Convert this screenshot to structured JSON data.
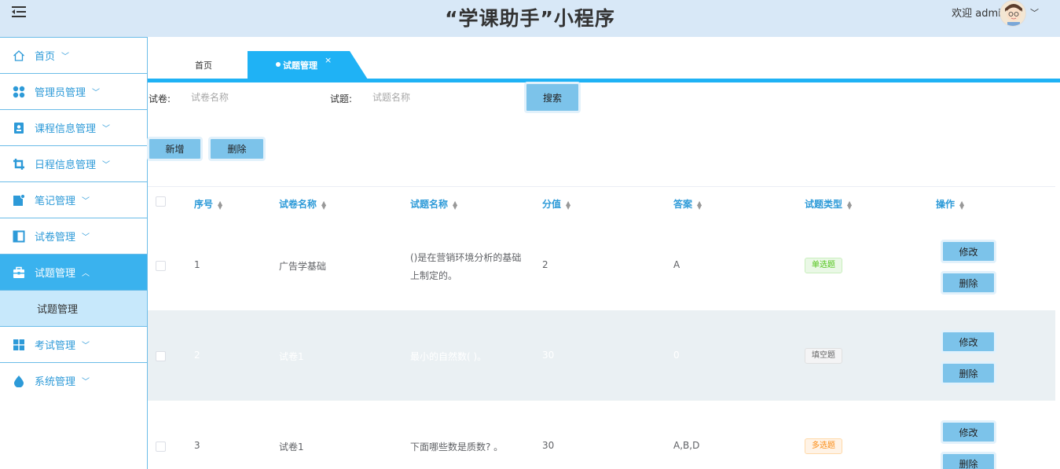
{
  "header": {
    "title": "“学课助手”小程序",
    "welcome": "欢迎 admin"
  },
  "sidebar": {
    "items": [
      {
        "label": "首页",
        "icon": "home-icon"
      },
      {
        "label": "管理员管理",
        "icon": "grid-dots-icon"
      },
      {
        "label": "课程信息管理",
        "icon": "contact-book-icon"
      },
      {
        "label": "日程信息管理",
        "icon": "crop-icon"
      },
      {
        "label": "笔记管理",
        "icon": "note-icon"
      },
      {
        "label": "试卷管理",
        "icon": "panel-icon"
      },
      {
        "label": "试题管理",
        "icon": "toolbox-icon"
      },
      {
        "label": "考试管理",
        "icon": "tiles-icon"
      },
      {
        "label": "系统管理",
        "icon": "drop-icon"
      }
    ],
    "sub_item": "试题管理"
  },
  "tabs": {
    "home": "首页",
    "active": "试题管理",
    "close": "×"
  },
  "search": {
    "paper_label": "试卷:",
    "paper_placeholder": "试卷名称",
    "question_label": "试题:",
    "question_placeholder": "试题名称",
    "search_button": "搜索"
  },
  "actions": {
    "add": "新增",
    "delete": "删除"
  },
  "table": {
    "columns": [
      "序号",
      "试卷名称",
      "试题名称",
      "分值",
      "答案",
      "试题类型",
      "操作"
    ],
    "rows": [
      {
        "no": "1",
        "paper": "广告学基础",
        "question_l1": "()是在营销环境分析的基础",
        "question_l2": "上制定的。",
        "score": "2",
        "answer": "A",
        "type": "单选题"
      },
      {
        "no": "2",
        "paper": "试卷1",
        "question_l1": "最小的自然数( )。",
        "question_l2": "",
        "score": "30",
        "answer": "0",
        "type": "填空题"
      },
      {
        "no": "3",
        "paper": "试卷1",
        "question_l1": "下面哪些数是质数? 。",
        "question_l2": "",
        "score": "30",
        "answer": "A,B,D",
        "type": "多选题"
      }
    ],
    "edit_label": "修改",
    "delete_label": "删除"
  },
  "colors": {
    "accent": "#1fb2f5",
    "header_bg": "#d8e8f7",
    "button_bg": "#7cc3ea"
  }
}
